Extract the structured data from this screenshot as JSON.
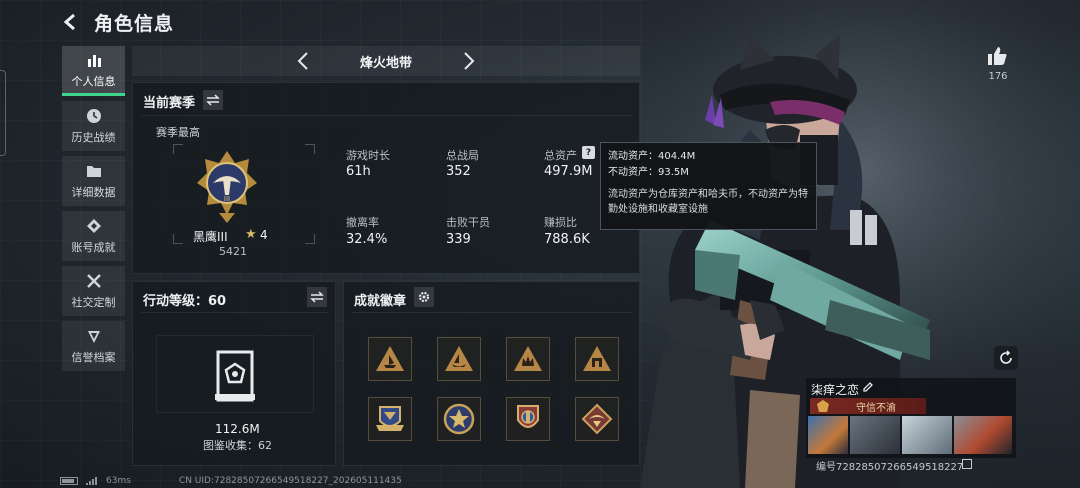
{
  "header": {
    "title": "角色信息",
    "back_icon": "back-arrow-icon"
  },
  "sidebar": {
    "items": [
      {
        "label": "个人信息",
        "icon": "bar-chart-icon",
        "active": true
      },
      {
        "label": "历史战绩",
        "icon": "clock-icon",
        "active": false
      },
      {
        "label": "详细数据",
        "icon": "folder-icon",
        "active": false
      },
      {
        "label": "账号成就",
        "icon": "diamond-medal-icon",
        "active": false
      },
      {
        "label": "社交定制",
        "icon": "tools-icon",
        "active": false
      },
      {
        "label": "信誉档案",
        "icon": "shield-icon",
        "active": false
      }
    ]
  },
  "mode": {
    "name": "烽火地带"
  },
  "season": {
    "title": "当前赛季",
    "subtitle": "赛季最高",
    "rank_name": "黑鹰III",
    "rank_stars": "4",
    "rank_points": "5421",
    "stats": [
      {
        "label": "游戏时长",
        "value": "61h"
      },
      {
        "label": "总战局",
        "value": "352"
      },
      {
        "label": "总资产",
        "value": "497.9M"
      },
      {
        "label": "撤离率",
        "value": "32.4%"
      },
      {
        "label": "击败干员",
        "value": "339"
      },
      {
        "label": "赚损比",
        "value": "788.6K"
      }
    ]
  },
  "tooltip": {
    "liquid": "流动资产：404.4M",
    "fixed": "不动资产：93.5M",
    "desc": "流动资产为仓库资产和哈夫币，不动资产为特勤处设施和收藏室设施"
  },
  "action": {
    "title": "行动等级：60",
    "collection_value": "112.6M",
    "collection_label": "图鉴收集：62"
  },
  "achievements": {
    "title": "成就徽章",
    "badges": [
      {
        "icon": "triangle-ship-badge-icon"
      },
      {
        "icon": "triangle-boat-badge-icon"
      },
      {
        "icon": "triangle-crown-badge-icon"
      },
      {
        "icon": "triangle-building-badge-icon"
      },
      {
        "icon": "scroll-crest-badge-icon"
      },
      {
        "icon": "star-medal-badge-icon"
      },
      {
        "icon": "shield-medal-badge-icon"
      },
      {
        "icon": "diamond-wing-badge-icon"
      }
    ]
  },
  "profile": {
    "likes": "176",
    "name": "柒痒之恋",
    "title_badge": "守信不渝",
    "id_text": "编号72828507266549518227"
  },
  "footer": {
    "ping": "63ms",
    "uid": "CN UID:72828507266549518227_202605111435"
  },
  "colors": {
    "accent_green": "#3fd48e",
    "rank_gold": "#d9b868",
    "badge_border": "#bea06e"
  }
}
